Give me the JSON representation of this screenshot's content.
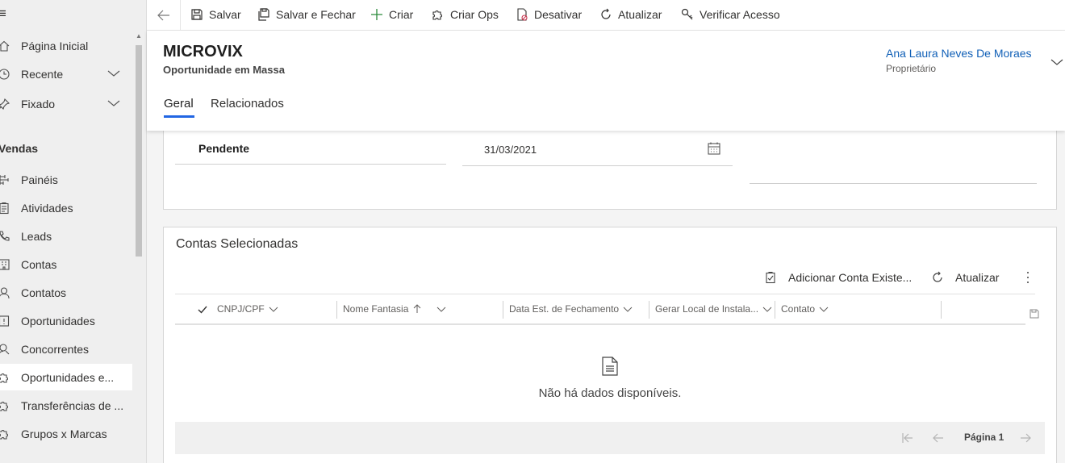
{
  "sidebar": {
    "menu_icon": "hamburger-icon",
    "items": [
      {
        "label": "Página Inicial",
        "icon": "home-icon"
      },
      {
        "label": "Recente",
        "icon": "clock-icon"
      },
      {
        "label": "Fixado",
        "icon": "pin-icon"
      },
      {
        "label": "Painéis",
        "icon": "dashboard-icon"
      },
      {
        "label": "Atividades",
        "icon": "clipboard-icon"
      },
      {
        "label": "Leads",
        "icon": "phone-icon"
      },
      {
        "label": "Contas",
        "icon": "building-icon"
      },
      {
        "label": "Contatos",
        "icon": "person-icon"
      },
      {
        "label": "Oportunidades",
        "icon": "opportunity-icon"
      },
      {
        "label": "Concorrentes",
        "icon": "competitor-icon"
      },
      {
        "label": "Oportunidades e...",
        "icon": "puzzle-icon"
      },
      {
        "label": "Transferências de ...",
        "icon": "puzzle-icon"
      },
      {
        "label": "Grupos x Marcas",
        "icon": "puzzle-icon"
      }
    ],
    "section_label": "Vendas"
  },
  "commandbar": {
    "back_icon": "back-arrow-icon",
    "buttons": [
      {
        "label": "Salvar",
        "icon": "save-icon"
      },
      {
        "label": "Salvar e Fechar",
        "icon": "save-close-icon"
      },
      {
        "label": "Criar",
        "icon": "plus-icon"
      },
      {
        "label": "Criar Ops",
        "icon": "puzzle-icon"
      },
      {
        "label": "Desativar",
        "icon": "deactivate-icon"
      },
      {
        "label": "Atualizar",
        "icon": "refresh-icon"
      },
      {
        "label": "Verificar Acesso",
        "icon": "key-icon"
      }
    ]
  },
  "header": {
    "title": "MICROVIX",
    "subtitle": "Oportunidade em Massa",
    "owner_name": "Ana Laura Neves De Moraes",
    "owner_label": "Proprietário",
    "tabs": [
      {
        "label": "Geral",
        "active": true
      },
      {
        "label": "Relacionados",
        "active": false
      }
    ]
  },
  "form": {
    "status_value": "Pendente",
    "date_value": "31/03/2021"
  },
  "subgrid": {
    "title": "Contas Selecionadas",
    "add_existing_label": "Adicionar Conta Existe...",
    "refresh_label": "Atualizar",
    "columns": [
      {
        "label": "CNPJ/CPF"
      },
      {
        "label": "Nome Fantasia"
      },
      {
        "label": "Data Est. de Fechamento"
      },
      {
        "label": "Gerar Local de Instala..."
      },
      {
        "label": "Contato"
      }
    ],
    "empty_message": "Não há dados disponíveis.",
    "page_label": "Página 1"
  },
  "colors": {
    "accent": "#2266e3",
    "link": "#1160b7",
    "sidebar_bg": "#efefef",
    "main_bg": "#f4f4f4"
  }
}
